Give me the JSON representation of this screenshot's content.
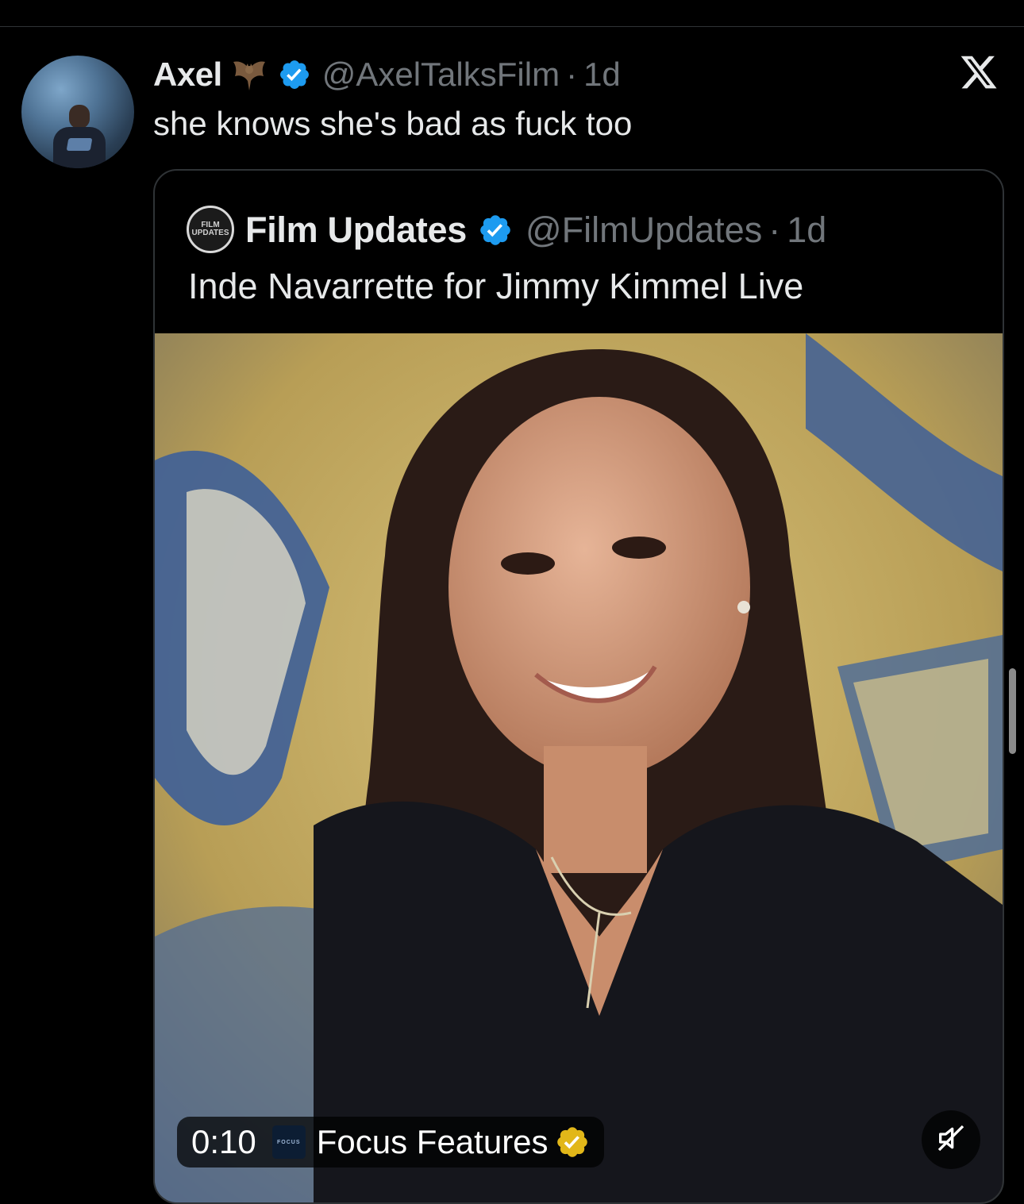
{
  "tweet": {
    "author_name": "Axel",
    "handle": "@AxelTalksFilm",
    "separator": "·",
    "time": "1d",
    "text": "she knows she's bad as fuck too"
  },
  "quote": {
    "author_name": "Film Updates",
    "avatar_text_1": "FILM",
    "avatar_text_2": "UPDATES",
    "handle": "@FilmUpdates",
    "separator": "·",
    "time": "1d",
    "text": "Inde Navarrette for Jimmy Kimmel Live",
    "media": {
      "duration": "0:10",
      "source_logo_text": "FOCUS",
      "source_name": "Focus Features"
    }
  },
  "colors": {
    "background": "#000000",
    "text_primary": "#e7e9ea",
    "text_secondary": "#71767b",
    "verified_blue": "#1d9bf0",
    "affiliate_gold": "#e2b719",
    "border": "#2f3336"
  },
  "icons": {
    "verified": "verified-badge-icon",
    "close": "x-logo-icon",
    "emoji": "bat-emoji-icon",
    "mute": "speaker-muted-icon"
  }
}
